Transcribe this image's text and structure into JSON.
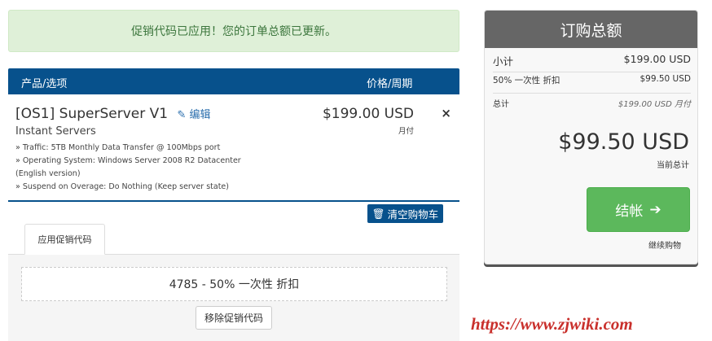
{
  "alert": {
    "message": "促销代码已应用！您的订单总额已更新。"
  },
  "cart": {
    "headers": {
      "product": "产品/选项",
      "price": "价格/周期"
    },
    "item": {
      "title": "[OS1] SuperServer V1",
      "edit_label": "编辑",
      "group": "Instant Servers",
      "details": [
        "» Traffic: 5TB Monthly Data Transfer @ 100Mbps port",
        "» Operating System: Windows Server 2008 R2 Datacenter (English version)",
        "» Suspend on Overage: Do Nothing (Keep server state)"
      ],
      "price": "$199.00 USD",
      "cycle": "月付",
      "remove_symbol": "×"
    },
    "empty_cart_label": "清空购物车"
  },
  "promo": {
    "tab_label": "应用促销代码",
    "applied_code": "4785 - 50% 一次性 折扣",
    "remove_label": "移除促销代码"
  },
  "summary": {
    "title": "订购总额",
    "subtotal_label": "小计",
    "subtotal_value": "$199.00 USD",
    "discount_label": "50% 一次性 折扣",
    "discount_value": "$99.50 USD",
    "total_label": "总计",
    "total_value": "$199.00 USD 月付",
    "grand_total": "$99.50 USD",
    "grand_total_label": "当前总计",
    "checkout_label": "结帐",
    "continue_label": "继续购物"
  },
  "watermark": {
    "text": "https://www.zjwiki.com"
  },
  "colors": {
    "primary": "#07518c",
    "success": "#5cb85c",
    "alert_bg": "#dff0d8",
    "alert_text": "#3c763d",
    "summary_header": "#666666"
  }
}
